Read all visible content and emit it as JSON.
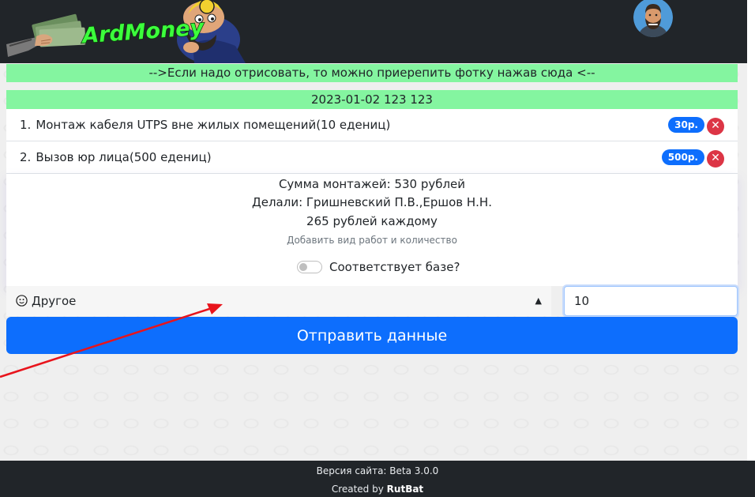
{
  "header": {
    "logo_text": "ArdMoney",
    "colors": {
      "bar": "#212529",
      "logo_text": "#3cff3c"
    }
  },
  "hint": {
    "text": "-->Если надо отрисовать, то можно приерепить фотку нажав сюда <--"
  },
  "entry": {
    "date_line": "2023-01-02 123 123"
  },
  "works": [
    {
      "num": "1.",
      "name": "Монтаж кабеля UTPS вне жилых помещений(10 едениц)",
      "price": "30р."
    },
    {
      "num": "2.",
      "name": "Вызов юр лица(500 едениц)",
      "price": "500р."
    }
  ],
  "summary": {
    "total": "Сумма монтажей: 530 рублей",
    "workers": "Делали: Гришневский П.В.,Ершов Н.Н.",
    "per_person": "265 рублей каждому",
    "add_hint": "Добавить вид работ и количество",
    "toggle_label": "Соответствует базе?",
    "toggle_on": false
  },
  "form": {
    "select_value": "Другое",
    "select_icon": "smiley-icon",
    "quantity_value": "10",
    "submit_label": "Отправить данные"
  },
  "footer": {
    "version": "Версия сайта: Beta 3.0.0",
    "created_prefix": "Created by",
    "author": "RutBat"
  },
  "colors": {
    "green_bar": "#84f5a0",
    "primary": "#0d6efd",
    "danger": "#dc3545",
    "annotation_arrow": "#e8141c"
  }
}
